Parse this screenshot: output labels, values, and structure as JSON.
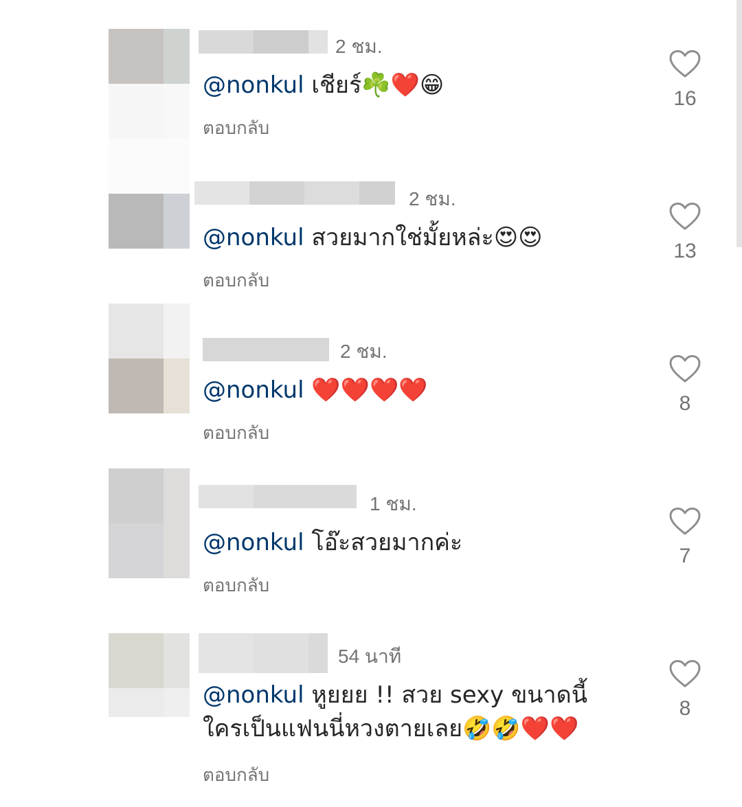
{
  "comments": [
    {
      "time": "2 ชม.",
      "mention": "@nonkul",
      "body": " เชียร์☘️❤️😁",
      "reply_label": "ตอบกลับ",
      "like_count": "16"
    },
    {
      "time": "2 ชม.",
      "mention": "@nonkul",
      "body": " สวยมากใช่มั้ยหล่ะ😍😍",
      "reply_label": "ตอบกลับ",
      "like_count": "13"
    },
    {
      "time": "2 ชม.",
      "mention": "@nonkul",
      "body": " ❤️❤️❤️❤️",
      "reply_label": "ตอบกลับ",
      "like_count": "8"
    },
    {
      "time": "1 ชม.",
      "mention": "@nonkul",
      "body": " โอ๊ะสวยมากค่ะ",
      "reply_label": "ตอบกลับ",
      "like_count": "7"
    },
    {
      "time": "54 นาที",
      "mention": "@nonkul",
      "body": " หูยยย !! สวย sexy ขนาดนี้ ใครเป็นแฟนนี่หวงตายเลย🤣🤣❤️❤️",
      "reply_label": "ตอบกลับ",
      "like_count": "8"
    }
  ],
  "icons": {
    "like": "heart-outline-icon"
  },
  "colors": {
    "mention": "#00376b",
    "secondary_text": "#737373",
    "primary_text": "#262626"
  }
}
